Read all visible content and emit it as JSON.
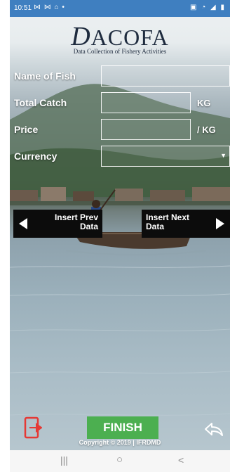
{
  "status_bar": {
    "time": "10:51",
    "left_icons": "⋈ ⋈ ⌂ •",
    "right_icons": "▣ ◔ ◢ ▮",
    "color": "#3f7fc0"
  },
  "logo": {
    "first_letter": "D",
    "brand_rest": "ACOFA",
    "tagline": "Data Collection of Fishery Activities"
  },
  "form": {
    "fish_label": "Name of Fish",
    "fish_value": "",
    "catch_label": "Total Catch",
    "catch_value": "",
    "catch_unit": "KG",
    "price_label": "Price",
    "price_value": "",
    "price_unit": "/ KG",
    "currency_label": "Currency",
    "currency_value": ""
  },
  "nav": {
    "prev_label_line1": "Insert Prev",
    "prev_label_line2": "Data",
    "next_label_line1": "Insert Next",
    "next_label_line2": "Data"
  },
  "footer": {
    "finish_label": "FINISH",
    "finish_color": "#4caf50",
    "copyright": "Copyright © 2019 | IFRDMD",
    "exit_icon": "exit-icon",
    "back_icon": "reply-icon"
  },
  "system_nav": {
    "recents": "|||",
    "home": "○",
    "back": "<"
  }
}
